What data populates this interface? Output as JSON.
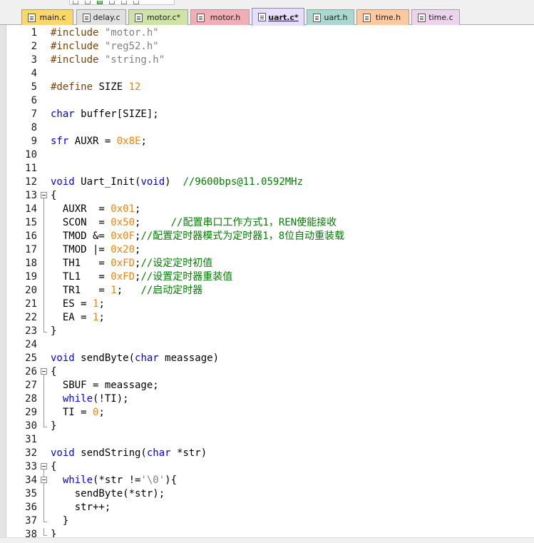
{
  "tabs": [
    {
      "label": "main.c",
      "icon": "c-file-icon",
      "color": "#fbd76a",
      "active": false
    },
    {
      "label": "delay.c",
      "icon": "c-file-icon",
      "color": "#e0e0e0",
      "active": false
    },
    {
      "label": "motor.c*",
      "icon": "c-file-icon",
      "color": "#cfe3a8",
      "active": false
    },
    {
      "label": "motor.h",
      "icon": "h-file-icon",
      "color": "#f2aeb6",
      "active": false
    },
    {
      "label": "uart.c*",
      "icon": "c-file-icon",
      "color": "#e6ddff",
      "active": true
    },
    {
      "label": "uart.h",
      "icon": "h-file-icon",
      "color": "#a8d8d0",
      "active": false
    },
    {
      "label": "time.h",
      "icon": "h-file-icon",
      "color": "#ffc9a0",
      "active": false
    },
    {
      "label": "time.c",
      "icon": "c-file-icon",
      "color": "#ecd5ec",
      "active": false
    }
  ],
  "colors": {
    "preprocessor": "#804000",
    "string": "#808080",
    "keyword": "#0000ff",
    "number": "#ff8000",
    "comment": "#008000"
  },
  "lines": [
    {
      "n": "1",
      "fold": "none",
      "tokens": [
        {
          "t": "#include ",
          "c": "pre"
        },
        {
          "t": "\"motor.h\"",
          "c": "str"
        }
      ]
    },
    {
      "n": "2",
      "fold": "none",
      "tokens": [
        {
          "t": "#include ",
          "c": "pre"
        },
        {
          "t": "\"reg52.h\"",
          "c": "str"
        }
      ]
    },
    {
      "n": "3",
      "fold": "none",
      "tokens": [
        {
          "t": "#include ",
          "c": "pre"
        },
        {
          "t": "\"string.h\"",
          "c": "str"
        }
      ]
    },
    {
      "n": "4",
      "fold": "none",
      "tokens": []
    },
    {
      "n": "5",
      "fold": "none",
      "tokens": [
        {
          "t": "#define ",
          "c": "pre"
        },
        {
          "t": "SIZE ",
          "c": ""
        },
        {
          "t": "12",
          "c": "num"
        }
      ]
    },
    {
      "n": "6",
      "fold": "none",
      "tokens": []
    },
    {
      "n": "7",
      "fold": "none",
      "tokens": [
        {
          "t": "char",
          "c": "kw"
        },
        {
          "t": " buffer[SIZE];",
          "c": ""
        }
      ]
    },
    {
      "n": "8",
      "fold": "none",
      "tokens": []
    },
    {
      "n": "9",
      "fold": "none",
      "tokens": [
        {
          "t": "sfr",
          "c": "kw"
        },
        {
          "t": " AUXR = ",
          "c": ""
        },
        {
          "t": "0x8E",
          "c": "num"
        },
        {
          "t": ";",
          "c": ""
        }
      ]
    },
    {
      "n": "10",
      "fold": "none",
      "tokens": []
    },
    {
      "n": "11",
      "fold": "none",
      "tokens": []
    },
    {
      "n": "12",
      "fold": "none",
      "tokens": [
        {
          "t": "void",
          "c": "kw"
        },
        {
          "t": " Uart_Init(",
          "c": ""
        },
        {
          "t": "void",
          "c": "kw"
        },
        {
          "t": ")  ",
          "c": ""
        },
        {
          "t": "//9600bps@11.0592MHz",
          "c": "cmt"
        }
      ]
    },
    {
      "n": "13",
      "fold": "open",
      "tokens": [
        {
          "t": "{",
          "c": ""
        }
      ]
    },
    {
      "n": "14",
      "fold": "bar",
      "tokens": [
        {
          "t": "  AUXR  = ",
          "c": ""
        },
        {
          "t": "0x01",
          "c": "num"
        },
        {
          "t": ";",
          "c": ""
        }
      ]
    },
    {
      "n": "15",
      "fold": "bar",
      "tokens": [
        {
          "t": "  SCON  = ",
          "c": ""
        },
        {
          "t": "0x50",
          "c": "num"
        },
        {
          "t": ";     ",
          "c": ""
        },
        {
          "t": "//配置串口工作方式1，REN使能接收",
          "c": "cmt"
        }
      ]
    },
    {
      "n": "16",
      "fold": "bar",
      "tokens": [
        {
          "t": "  TMOD &= ",
          "c": ""
        },
        {
          "t": "0x0F",
          "c": "num"
        },
        {
          "t": ";",
          "c": ""
        },
        {
          "t": "//配置定时器模式为定时器1，8位自动重装载",
          "c": "cmt"
        }
      ]
    },
    {
      "n": "17",
      "fold": "bar",
      "tokens": [
        {
          "t": "  TMOD |= ",
          "c": ""
        },
        {
          "t": "0x20",
          "c": "num"
        },
        {
          "t": ";",
          "c": ""
        }
      ]
    },
    {
      "n": "18",
      "fold": "bar",
      "tokens": [
        {
          "t": "  TH1   = ",
          "c": ""
        },
        {
          "t": "0xFD",
          "c": "num"
        },
        {
          "t": ";",
          "c": ""
        },
        {
          "t": "//设定定时初值",
          "c": "cmt"
        }
      ]
    },
    {
      "n": "19",
      "fold": "bar",
      "tokens": [
        {
          "t": "  TL1   = ",
          "c": ""
        },
        {
          "t": "0xFD",
          "c": "num"
        },
        {
          "t": ";",
          "c": ""
        },
        {
          "t": "//设置定时器重装值",
          "c": "cmt"
        }
      ]
    },
    {
      "n": "20",
      "fold": "bar",
      "tokens": [
        {
          "t": "  TR1   = ",
          "c": ""
        },
        {
          "t": "1",
          "c": "num"
        },
        {
          "t": ";   ",
          "c": ""
        },
        {
          "t": "//启动定时器",
          "c": "cmt"
        }
      ]
    },
    {
      "n": "21",
      "fold": "bar",
      "tokens": [
        {
          "t": "  ES = ",
          "c": ""
        },
        {
          "t": "1",
          "c": "num"
        },
        {
          "t": ";",
          "c": ""
        }
      ]
    },
    {
      "n": "22",
      "fold": "bar",
      "tokens": [
        {
          "t": "  EA = ",
          "c": ""
        },
        {
          "t": "1",
          "c": "num"
        },
        {
          "t": ";",
          "c": ""
        }
      ]
    },
    {
      "n": "23",
      "fold": "end",
      "tokens": [
        {
          "t": "}",
          "c": ""
        }
      ]
    },
    {
      "n": "24",
      "fold": "none",
      "tokens": []
    },
    {
      "n": "25",
      "fold": "none",
      "tokens": [
        {
          "t": "void",
          "c": "kw"
        },
        {
          "t": " sendByte(",
          "c": ""
        },
        {
          "t": "char",
          "c": "kw"
        },
        {
          "t": " meassage)",
          "c": ""
        }
      ]
    },
    {
      "n": "26",
      "fold": "open",
      "tokens": [
        {
          "t": "{",
          "c": ""
        }
      ]
    },
    {
      "n": "27",
      "fold": "bar",
      "tokens": [
        {
          "t": "  SBUF = meassage;",
          "c": ""
        }
      ]
    },
    {
      "n": "28",
      "fold": "bar",
      "tokens": [
        {
          "t": "  ",
          "c": ""
        },
        {
          "t": "while",
          "c": "kw"
        },
        {
          "t": "(!TI);",
          "c": ""
        }
      ]
    },
    {
      "n": "29",
      "fold": "bar",
      "tokens": [
        {
          "t": "  TI = ",
          "c": ""
        },
        {
          "t": "0",
          "c": "num"
        },
        {
          "t": ";",
          "c": ""
        }
      ]
    },
    {
      "n": "30",
      "fold": "end",
      "tokens": [
        {
          "t": "}",
          "c": ""
        }
      ]
    },
    {
      "n": "31",
      "fold": "none",
      "tokens": []
    },
    {
      "n": "32",
      "fold": "none",
      "tokens": [
        {
          "t": "void",
          "c": "kw"
        },
        {
          "t": " sendString(",
          "c": ""
        },
        {
          "t": "char",
          "c": "kw"
        },
        {
          "t": " *str)",
          "c": ""
        }
      ]
    },
    {
      "n": "33",
      "fold": "open",
      "tokens": [
        {
          "t": "{",
          "c": ""
        }
      ]
    },
    {
      "n": "34",
      "fold": "open-inner",
      "tokens": [
        {
          "t": "  ",
          "c": ""
        },
        {
          "t": "while",
          "c": "kw"
        },
        {
          "t": "(*str !=",
          "c": ""
        },
        {
          "t": "'\\0'",
          "c": "str"
        },
        {
          "t": "){",
          "c": ""
        }
      ]
    },
    {
      "n": "35",
      "fold": "bar",
      "tokens": [
        {
          "t": "    sendByte(*str);",
          "c": ""
        }
      ]
    },
    {
      "n": "36",
      "fold": "bar",
      "tokens": [
        {
          "t": "    str++;",
          "c": ""
        }
      ]
    },
    {
      "n": "37",
      "fold": "end-inner",
      "tokens": [
        {
          "t": "  }",
          "c": ""
        }
      ]
    },
    {
      "n": "38",
      "fold": "end",
      "tokens": [
        {
          "t": "}",
          "c": ""
        }
      ]
    }
  ]
}
